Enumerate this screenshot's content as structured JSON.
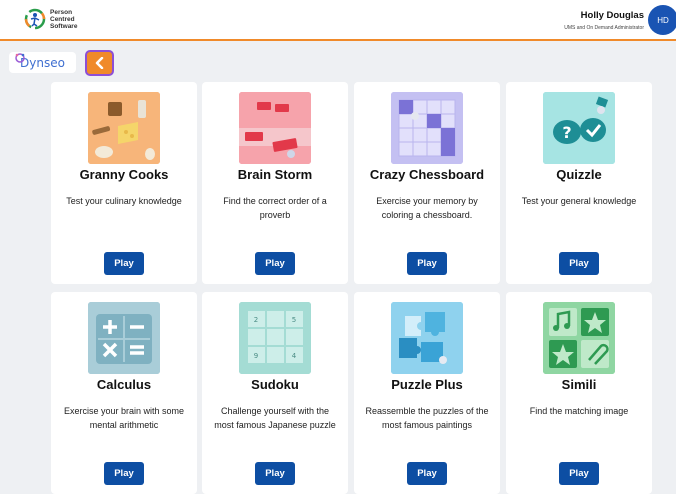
{
  "header": {
    "logo_text": "Person Centred Software",
    "user_name": "Holly Douglas",
    "user_role": "UMS and On Demand Administrator",
    "avatar_initials": "HD"
  },
  "toolbar": {
    "brand": "Dynseo"
  },
  "games": [
    {
      "title": "Granny Cooks",
      "description": "Test your culinary knowledge",
      "play": "Play",
      "icon": "cooking-icon"
    },
    {
      "title": "Brain Storm",
      "description": "Find the correct order of a proverb",
      "play": "Play",
      "icon": "word-cards-icon"
    },
    {
      "title": "Crazy Chessboard",
      "description": "Exercise your memory by coloring a chessboard.",
      "play": "Play",
      "icon": "chessboard-icon"
    },
    {
      "title": "Quizzle",
      "description": "Test your general knowledge",
      "play": "Play",
      "icon": "quiz-bubbles-icon"
    },
    {
      "title": "Calculus",
      "description": "Exercise your brain with some mental arithmetic",
      "play": "Play",
      "icon": "calculator-icon"
    },
    {
      "title": "Sudoku",
      "description": "Challenge yourself with the most famous Japanese puzzle",
      "play": "Play",
      "icon": "sudoku-grid-icon",
      "grid_numbers": [
        "2",
        "5",
        "9",
        "4"
      ]
    },
    {
      "title": "Puzzle Plus",
      "description": "Reassemble the puzzles of the most famous paintings",
      "play": "Play",
      "icon": "puzzle-pieces-icon"
    },
    {
      "title": "Simili",
      "description": "Find the matching image",
      "play": "Play",
      "icon": "matching-images-icon"
    }
  ],
  "colors": {
    "accent": "#f08a2a",
    "play_button": "#0d4ea3",
    "avatar": "#1a54b3"
  }
}
